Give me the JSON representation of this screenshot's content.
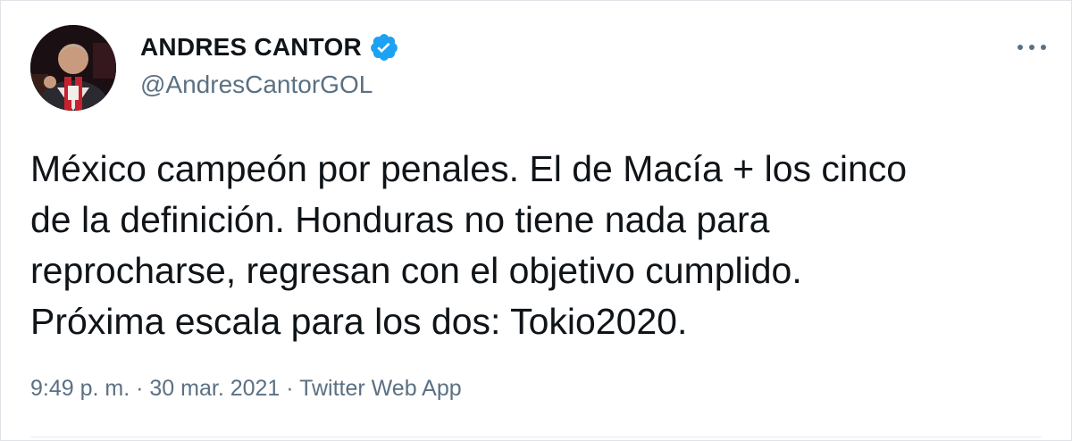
{
  "author": {
    "display_name": "ANDRES CANTOR",
    "handle": "@AndresCantorGOL",
    "verified": true,
    "verified_icon": "verified-badge-icon",
    "avatar_icon": "profile-photo"
  },
  "menu": {
    "icon": "more-options-icon"
  },
  "tweet": {
    "lines": [
      "México campeón por penales. El de Macía + los cinco",
      "de la definición. Honduras no tiene nada para",
      "reprocharse, regresan con el objetivo cumplido.",
      "Próxima escala para los dos: Tokio2020."
    ]
  },
  "meta": {
    "time": "9:49 p. m.",
    "separator": " · ",
    "date": "30 mar. 2021",
    "source": "Twitter Web App"
  },
  "colors": {
    "accent": "#1da1f2",
    "text": "#0f1419",
    "secondary": "#5b7083"
  }
}
